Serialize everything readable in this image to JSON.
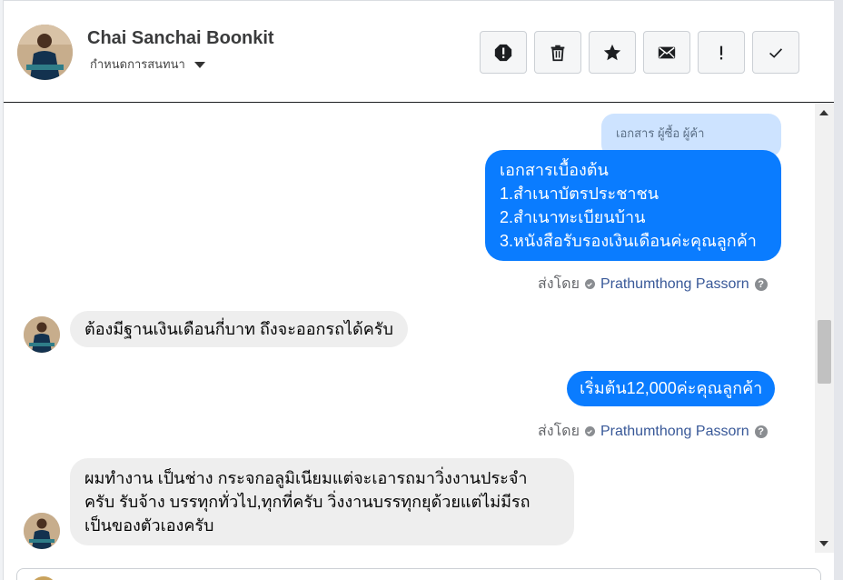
{
  "header": {
    "contact_name": "Chai Sanchai Boonkit",
    "assign_label": "กำหนดการสนทนา"
  },
  "toolbar": {
    "buttons": [
      {
        "name": "mark-spam-button",
        "icon": "alert-octagon-icon"
      },
      {
        "name": "delete-button",
        "icon": "trash-icon"
      },
      {
        "name": "star-button",
        "icon": "star-icon"
      },
      {
        "name": "mark-unread-button",
        "icon": "envelope-icon"
      },
      {
        "name": "mark-important-button",
        "icon": "exclamation-icon"
      },
      {
        "name": "mark-done-button",
        "icon": "check-icon"
      }
    ]
  },
  "messages": {
    "tag_label": "เอกสาร ผู้ซื้อ ผู้ค้า",
    "msg1_lines": [
      "เอกสารเบื้องต้น",
      "1.สำเนาบัตรประชาชน",
      "2.สำเนาทะเบียนบ้าน",
      "3.หนังสือรับรองเงินเดือนค่ะคุณลูกค้า"
    ],
    "sent_by_label": "ส่งโดย",
    "sender_name": "Prathumthong Passorn",
    "msg2": "ต้องมีฐานเงินเดือนกี่บาท ถึงจะออกรถได้ครับ",
    "msg3": "เริ่มต้น12,000ค่ะคุณลูกค้า",
    "msg4_lines": [
      "ผมทำงาน เป็นช่าง กระจกอลูมิเนียมแต่จะเอารถมาวิ่งงานประจำ",
      "ครับ รับจ้าง บรรทุกทั่วไป,ทุกที่ครับ วิ่งงานบรรทุกยุด้วยแต่ไม่มีรถ",
      "เป็นของตัวเองครับ"
    ]
  },
  "colors": {
    "outgoing_bubble": "#0a7cff",
    "incoming_bubble": "#eeeeee",
    "tag_bubble": "#cde3ff",
    "sender_link": "#385898"
  }
}
